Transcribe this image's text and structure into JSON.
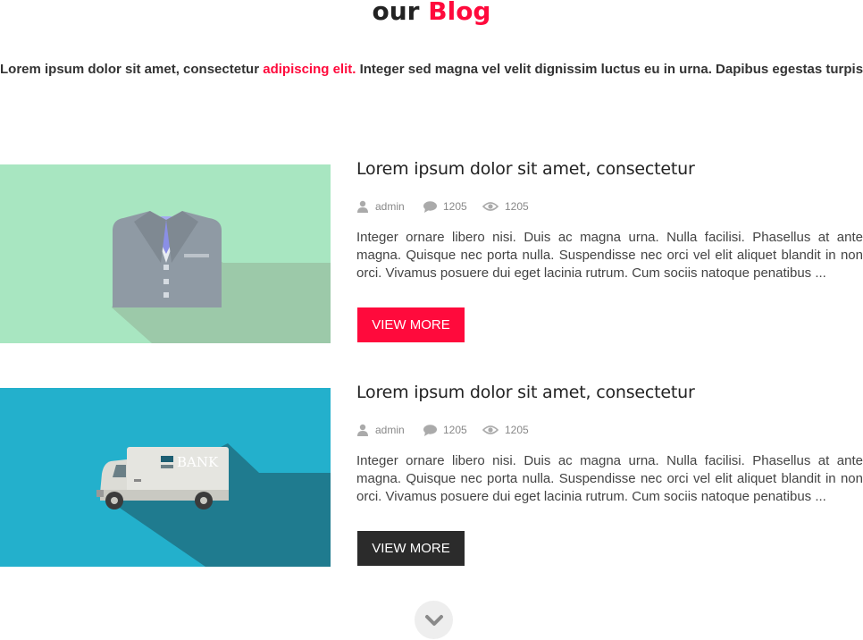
{
  "section": {
    "heading_prefix": "our",
    "heading_accent": "Blog",
    "intro_before": "Lorem ipsum dolor sit amet, consectetur ",
    "intro_link": "adipiscing elit.",
    "intro_after": " Integer sed magna vel velit dignissim luctus eu in urna. Dapibus egestas turpis."
  },
  "colors": {
    "accent": "#ff0a3c",
    "dark_button": "#2b2b2b",
    "thumb_green": "#a8e6c1",
    "thumb_blue": "#23b0cc"
  },
  "posts": [
    {
      "title": "Lorem ipsum dolor sit amet, consectetur",
      "author": "admin",
      "comments": "1205",
      "views": "1205",
      "excerpt": "Integer ornare libero nisi. Duis ac magna urna. Nulla facilisi. Phasellus at ante magna. Quisque nec porta nulla. Suspendisse nec orci vel elit aliquet blandit in non orci. Vivamus posuere dui eget lacinia rutrum. Cum sociis natoque penatibus ...",
      "button": "VIEW MORE",
      "image_icon": "suit-jacket-icon"
    },
    {
      "title": "Lorem ipsum dolor sit amet, consectetur",
      "author": "admin",
      "comments": "1205",
      "views": "1205",
      "excerpt": "Integer ornare libero nisi. Duis ac magna urna. Nulla facilisi. Phasellus at ante magna. Quisque nec porta nulla. Suspendisse nec orci vel elit aliquet blandit in non orci. Vivamus posuere dui eget lacinia rutrum. Cum sociis natoque penatibus ...",
      "button": "VIEW MORE",
      "image_icon": "bank-truck-icon",
      "image_text": "BANK"
    }
  ],
  "scroll_icon": "chevron-down-icon"
}
